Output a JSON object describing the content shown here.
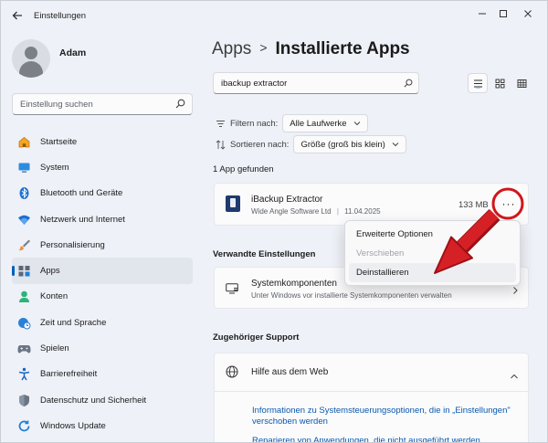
{
  "window": {
    "title": "Einstellungen",
    "controls": {
      "minimize": "—",
      "maximize": "☐",
      "close": "✕"
    }
  },
  "profile": {
    "name": "Adam"
  },
  "sidebar": {
    "search_placeholder": "Einstellung suchen",
    "items": [
      {
        "label": "Startseite",
        "icon": "home-icon"
      },
      {
        "label": "System",
        "icon": "monitor-icon"
      },
      {
        "label": "Bluetooth und Geräte",
        "icon": "bluetooth-icon"
      },
      {
        "label": "Netzwerk und Internet",
        "icon": "wifi-icon"
      },
      {
        "label": "Personalisierung",
        "icon": "brush-icon"
      },
      {
        "label": "Apps",
        "icon": "apps-icon",
        "active": true
      },
      {
        "label": "Konten",
        "icon": "account-icon"
      },
      {
        "label": "Zeit und Sprache",
        "icon": "clock-globe-icon"
      },
      {
        "label": "Spielen",
        "icon": "gamepad-icon"
      },
      {
        "label": "Barrierefreiheit",
        "icon": "accessibility-icon"
      },
      {
        "label": "Datenschutz und Sicherheit",
        "icon": "shield-icon"
      },
      {
        "label": "Windows Update",
        "icon": "update-icon"
      }
    ]
  },
  "breadcrumb": {
    "parent": "Apps",
    "separator": ">",
    "current": "Installierte Apps"
  },
  "search": {
    "value": "ibackup extractor"
  },
  "filters": {
    "filter_label": "Filtern nach:",
    "filter_value": "Alle Laufwerke",
    "sort_label": "Sortieren nach:",
    "sort_value": "Größe (groß bis klein)"
  },
  "results": {
    "count_text": "1 App gefunden"
  },
  "app": {
    "name": "iBackup Extractor",
    "publisher": "Wide Angle Software Ltd",
    "separator": "|",
    "date": "11.04.2025",
    "size": "133 MB",
    "more_label": "···"
  },
  "context_menu": {
    "items": [
      {
        "label": "Erweiterte Optionen",
        "state": "normal"
      },
      {
        "label": "Verschieben",
        "state": "disabled"
      },
      {
        "label": "Deinstallieren",
        "state": "hover"
      }
    ]
  },
  "related": {
    "heading": "Verwandte Einstellungen",
    "item_title": "Systemkomponenten",
    "item_subtitle": "Unter Windows vor installierte Systemkomponenten verwalten"
  },
  "support": {
    "heading": "Zugehöriger Support",
    "item_title": "Hilfe aus dem Web",
    "links": [
      "Informationen zu Systemsteuerungsoptionen, die in „Einstellungen\" verschoben werden",
      "Reparieren von Anwendungen, die nicht ausgeführt werden"
    ]
  },
  "colors": {
    "accent": "#005fb8",
    "annotation_red": "#d0161b",
    "link": "#0a58ad"
  }
}
